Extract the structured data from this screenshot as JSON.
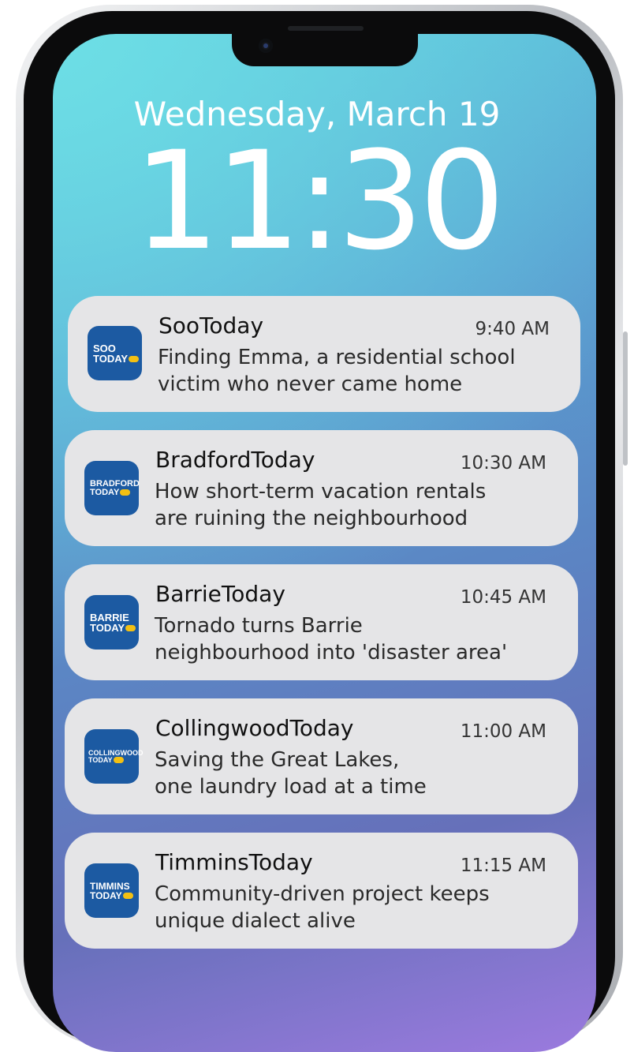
{
  "lockscreen": {
    "date": "Wednesday, March 19",
    "time": "11:30"
  },
  "notifications": [
    {
      "app": "SooToday",
      "icon_line1": "SOO",
      "icon_line2": "TODAY",
      "time": "9:40 AM",
      "body": "Finding Emma, a residential school\nvictim who never came home"
    },
    {
      "app": "BradfordToday",
      "icon_line1": "BRADFORD",
      "icon_line2": "TODAY",
      "time": "10:30 AM",
      "body": "How short-term vacation rentals\nare ruining the neighbourhood"
    },
    {
      "app": "BarrieToday",
      "icon_line1": "BARRIE",
      "icon_line2": "TODAY",
      "time": "10:45 AM",
      "body": "Tornado turns Barrie\nneighbourhood into 'disaster area'"
    },
    {
      "app": "CollingwoodToday",
      "icon_line1": "COLLINGWOOD",
      "icon_line2": "TODAY",
      "time": "11:00 AM",
      "body": "Saving the Great Lakes,\none laundry load at a time"
    },
    {
      "app": "TimminsToday",
      "icon_line1": "TIMMINS",
      "icon_line2": "TODAY",
      "time": "11:15 AM",
      "body": "Community-driven project keeps\nunique dialect alive"
    }
  ],
  "icons": {
    "app_icon_bg": "#1c5aa2",
    "app_icon_dot": "#f3c013"
  }
}
